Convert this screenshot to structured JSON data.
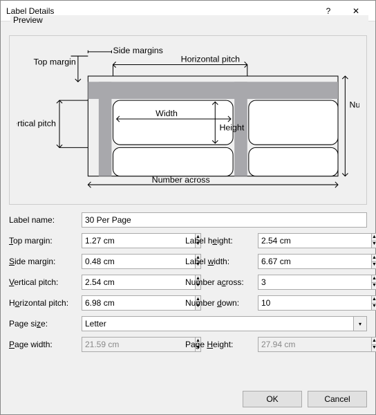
{
  "window": {
    "title": "Label Details",
    "help_icon": "?",
    "close_icon": "✕"
  },
  "preview": {
    "group_label": "Preview",
    "labels": {
      "side_margins": "Side margins",
      "top_margin": "Top margin",
      "horizontal_pitch": "Horizontal pitch",
      "vertical_pitch": "Vertical pitch",
      "width": "Width",
      "height": "Height",
      "number_down": "Number down",
      "number_across": "Number across"
    }
  },
  "fields": {
    "label_name": {
      "label": "Label name:",
      "value": "30 Per Page"
    },
    "top_margin": {
      "label": "Top margin:",
      "value": "1.27 cm",
      "ak": "T"
    },
    "side_margin": {
      "label": "Side margin:",
      "value": "0.48 cm",
      "ak": "S"
    },
    "vertical_pitch": {
      "label": "Vertical pitch:",
      "value": "2.54 cm",
      "ak": "V"
    },
    "horizontal_pitch": {
      "label": "Horizontal pitch:",
      "value": "6.98 cm",
      "ak": "o"
    },
    "label_height": {
      "label": "Label height:",
      "value": "2.54 cm",
      "ak": "e"
    },
    "label_width": {
      "label": "Label width:",
      "value": "6.67 cm",
      "ak": "w"
    },
    "number_across": {
      "label": "Number across:",
      "value": "3",
      "ak": "c"
    },
    "number_down": {
      "label": "Number down:",
      "value": "10",
      "ak": "d"
    },
    "page_size": {
      "label": "Page size:",
      "value": "Letter",
      "ak": "z"
    },
    "page_width": {
      "label": "Page width:",
      "value": "21.59 cm",
      "ak": "P"
    },
    "page_height": {
      "label": "Page Height:",
      "value": "27.94 cm",
      "ak": "H"
    }
  },
  "buttons": {
    "ok": "OK",
    "cancel": "Cancel"
  }
}
